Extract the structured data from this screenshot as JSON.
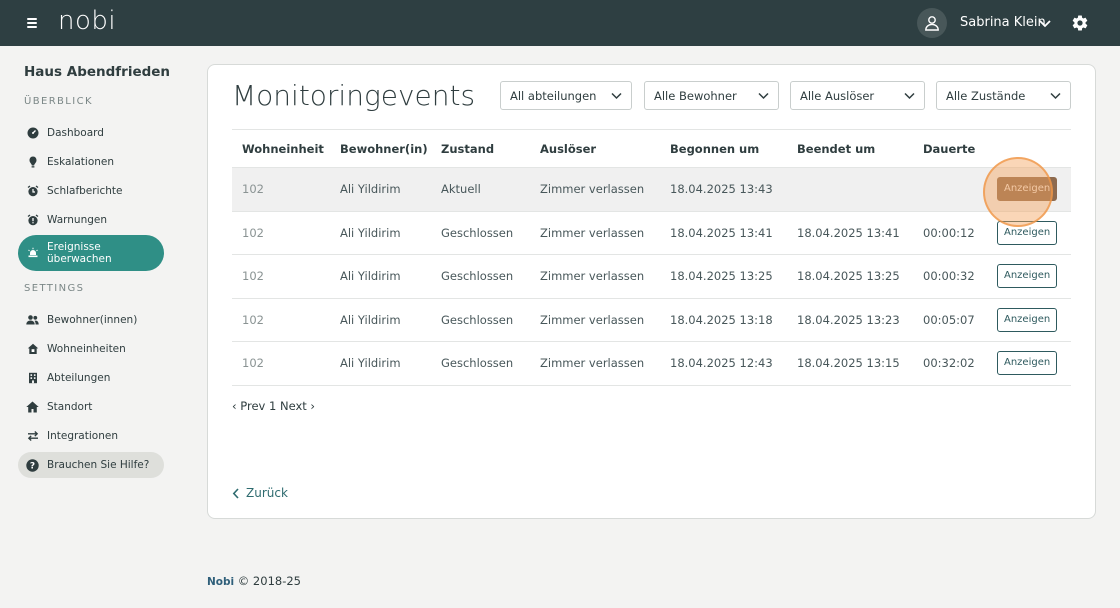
{
  "topbar": {
    "logo": "nobi",
    "user_name": "Sabrina Klein"
  },
  "sidebar": {
    "facility": "Haus Abendfrieden",
    "section_overview": "ÜBERBLICK",
    "overview_items": [
      {
        "label": "Dashboard",
        "icon": "dashboard-icon"
      },
      {
        "label": "Eskalationen",
        "icon": "escalation-icon"
      },
      {
        "label": "Schlafberichte",
        "icon": "sleep-report-icon"
      },
      {
        "label": "Warnungen",
        "icon": "warning-icon"
      },
      {
        "label": "Ereignisse überwachen",
        "icon": "monitor-events-icon",
        "active": true
      }
    ],
    "section_settings": "SETTINGS",
    "settings_items": [
      {
        "label": "Bewohner(innen)",
        "icon": "residents-icon"
      },
      {
        "label": "Wohneinheiten",
        "icon": "units-icon"
      },
      {
        "label": "Abteilungen",
        "icon": "departments-icon"
      },
      {
        "label": "Standort",
        "icon": "location-icon"
      },
      {
        "label": "Integrationen",
        "icon": "integrations-icon"
      }
    ],
    "help": "Brauchen Sie Hilfe?"
  },
  "main": {
    "title": "Monitoringevents",
    "filters": [
      {
        "value": "All abteilungen"
      },
      {
        "value": "Alle Bewohner"
      },
      {
        "value": "Alle Auslöser"
      },
      {
        "value": "Alle Zustände"
      }
    ],
    "table": {
      "headers": [
        "Wohneinheit",
        "Bewohner(in)",
        "Zustand",
        "Auslöser",
        "Begonnen um",
        "Beendet um",
        "Dauerte",
        ""
      ],
      "rows": [
        {
          "unit": "102",
          "resident": "Ali Yildirim",
          "state": "Aktuell",
          "trigger": "Zimmer verlassen",
          "started": "18.04.2025 13:43",
          "ended": "",
          "duration": "",
          "action": "Anzeigen"
        },
        {
          "unit": "102",
          "resident": "Ali Yildirim",
          "state": "Geschlossen",
          "trigger": "Zimmer verlassen",
          "started": "18.04.2025 13:41",
          "ended": "18.04.2025 13:41",
          "duration": "00:00:12",
          "action": "Anzeigen"
        },
        {
          "unit": "102",
          "resident": "Ali Yildirim",
          "state": "Geschlossen",
          "trigger": "Zimmer verlassen",
          "started": "18.04.2025 13:25",
          "ended": "18.04.2025 13:25",
          "duration": "00:00:32",
          "action": "Anzeigen"
        },
        {
          "unit": "102",
          "resident": "Ali Yildirim",
          "state": "Geschlossen",
          "trigger": "Zimmer verlassen",
          "started": "18.04.2025 13:18",
          "ended": "18.04.2025 13:23",
          "duration": "00:05:07",
          "action": "Anzeigen"
        },
        {
          "unit": "102",
          "resident": "Ali Yildirim",
          "state": "Geschlossen",
          "trigger": "Zimmer verlassen",
          "started": "18.04.2025 12:43",
          "ended": "18.04.2025 13:15",
          "duration": "00:32:02",
          "action": "Anzeigen"
        }
      ]
    },
    "pager": {
      "prev": "‹ Prev",
      "page": "1",
      "next": "Next ›"
    },
    "back": "Zurück"
  },
  "footer": {
    "brand": "Nobi",
    "copyright": "© 2018-25"
  },
  "colors": {
    "topbar": "#2e3f42",
    "accent": "#2f8f86",
    "pressed_button": "#8e6a4e"
  }
}
